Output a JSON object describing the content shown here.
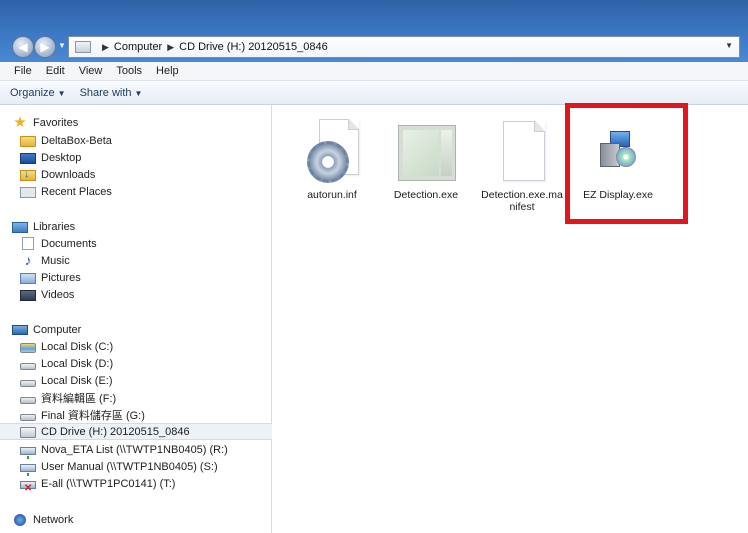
{
  "address_bar": {
    "crumbs": [
      "Computer",
      "CD Drive (H:) 20120515_0846"
    ]
  },
  "menu": {
    "items": [
      "File",
      "Edit",
      "View",
      "Tools",
      "Help"
    ]
  },
  "command_bar": {
    "organize": "Organize",
    "share_with": "Share with"
  },
  "nav_pane": {
    "favorites": {
      "header": "Favorites",
      "items": [
        "DeltaBox-Beta",
        "Desktop",
        "Downloads",
        "Recent Places"
      ]
    },
    "libraries": {
      "header": "Libraries",
      "items": [
        "Documents",
        "Music",
        "Pictures",
        "Videos"
      ]
    },
    "computer": {
      "header": "Computer",
      "items": [
        "Local Disk (C:)",
        "Local Disk (D:)",
        "Local Disk (E:)",
        "資料編輯區 (F:)",
        "Final 資料儲存區 (G:)",
        "CD Drive (H:) 20120515_0846",
        "Nova_ETA List (\\\\TWTP1NB0405) (R:)",
        "User Manual (\\\\TWTP1NB0405) (S:)",
        "E-all (\\\\TWTP1PC0141) (T:)"
      ],
      "selected_index": 5
    },
    "network": {
      "header": "Network"
    }
  },
  "files": [
    {
      "name": "autorun.inf",
      "icon": "settings-file-icon"
    },
    {
      "name": "Detection.exe",
      "icon": "application-window-icon"
    },
    {
      "name": "Detection.exe.manifest",
      "icon": "blank-document-icon"
    },
    {
      "name": "EZ Display.exe",
      "icon": "installer-icon"
    }
  ],
  "highlight": {
    "color": "#e3141b",
    "target": "EZ Display.exe"
  }
}
